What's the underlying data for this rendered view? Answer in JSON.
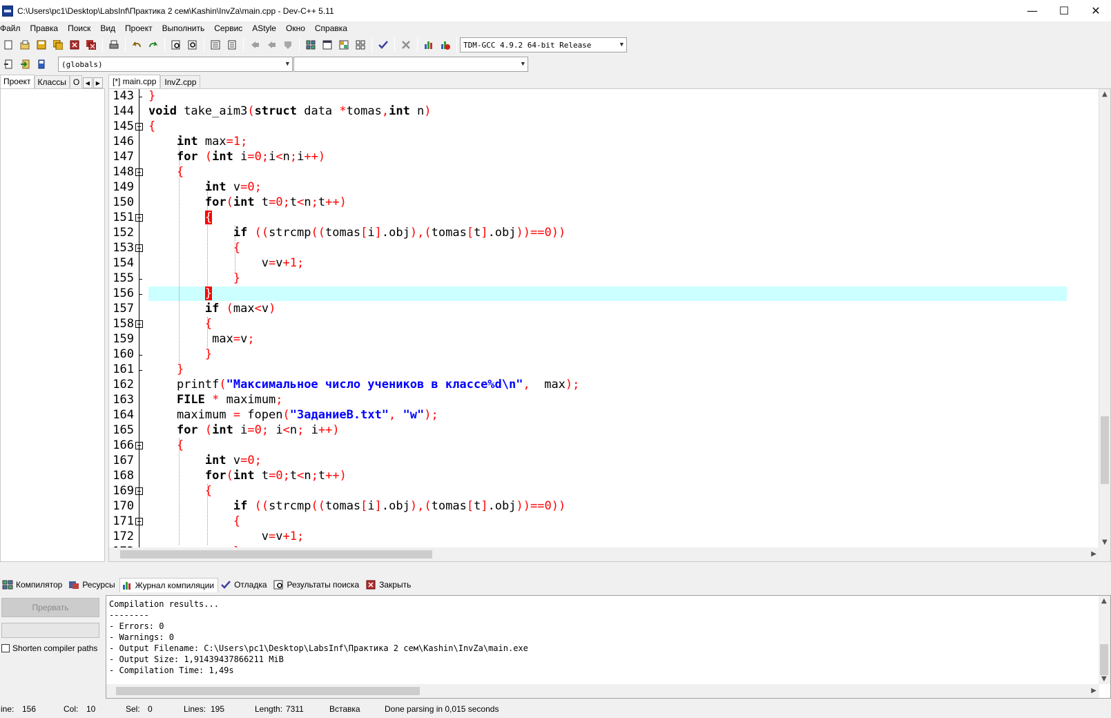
{
  "window": {
    "title": "C:\\Users\\pc1\\Desktop\\LabsInf\\Практика 2 сем\\Kashin\\InvZa\\main.cpp - Dev-C++ 5.11",
    "minimize": "—",
    "maximize": "☐",
    "close": "✕"
  },
  "menu": [
    "Файл",
    "Правка",
    "Поиск",
    "Вид",
    "Проект",
    "Выполнить",
    "Сервис",
    "AStyle",
    "Окно",
    "Справка"
  ],
  "toolbar": {
    "compiler": "TDM-GCC 4.9.2 64-bit Release",
    "scope": "(globals)",
    "member": ""
  },
  "left_tabs": [
    "Проект",
    "Классы",
    "О"
  ],
  "editor_tabs": [
    "[*] main.cpp",
    "InvZ.cpp"
  ],
  "editor": {
    "first_line": 143,
    "highlight_line": 156,
    "lines": [
      "}",
      "void take_aim3(struct data *tomas,int n)",
      "{",
      "    int max=1;",
      "    for (int i=0;i<n;i++)",
      "    {",
      "        int v=0;",
      "        for(int t=0;t<n;t++)",
      "        {",
      "            if ((strcmp((tomas[i].obj),(tomas[t].obj))==0))",
      "            {",
      "                v=v+1;",
      "            }",
      "        }",
      "        if (max<v)",
      "        {",
      "         max=v;",
      "        }",
      "    }",
      "    printf(\"Максимальное число учеников в классе%d\\n\",  max);",
      "    FILE * maximum;",
      "    maximum = fopen(\"ЗаданиеB.txt\", \"w\");",
      "    for (int i=0; i<n; i++)",
      "    {",
      "        int v=0;",
      "        for(int t=0;t<n;t++)",
      "        {",
      "            if ((strcmp((tomas[i].obj),(tomas[t].obj))==0))",
      "            {",
      "                v=v+1;",
      "            }"
    ]
  },
  "bottom_tabs": [
    "Компилятор",
    "Ресурсы",
    "Журнал компиляции",
    "Отладка",
    "Результаты поиска",
    "Закрыть"
  ],
  "bottom_panel": {
    "abort_label": "Прервать",
    "shorten_label": "Shorten compiler paths",
    "shorten_checked": false
  },
  "log": [
    "Compilation results...",
    "--------",
    "- Errors: 0",
    "- Warnings: 0",
    "- Output Filename: C:\\Users\\pc1\\Desktop\\LabsInf\\Практика 2 сем\\Kashin\\InvZa\\main.exe",
    "- Output Size: 1,91439437866211 MiB",
    "- Compilation Time: 1,49s"
  ],
  "status": {
    "line_label": "ine:",
    "line_value": "156",
    "col_label": "Col:",
    "col_value": "10",
    "sel_label": "Sel:",
    "sel_value": "0",
    "lines_label": "Lines:",
    "lines_value": "195",
    "length_label": "Length:",
    "length_value": "7311",
    "mode": "Вставка",
    "message": "Done parsing in 0,015 seconds"
  },
  "colors": {
    "keyword": "#000000",
    "symbol": "#ff0000",
    "string": "#0000ff",
    "current_line": "#ccffff",
    "brace_match": "#ff0000"
  }
}
